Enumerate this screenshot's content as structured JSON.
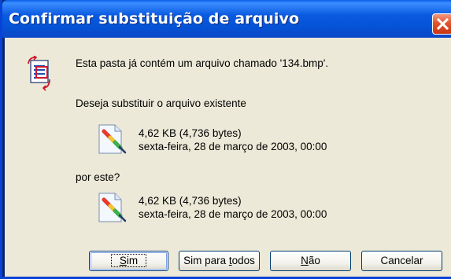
{
  "window": {
    "title": "Confirmar substituição de arquivo"
  },
  "message": {
    "intro": "Esta pasta já contém um arquivo chamado '134.bmp'.",
    "question": "Deseja substituir o arquivo existente",
    "replacement_prompt": "por este?"
  },
  "existing_file": {
    "size": "4,62 KB (4,736 bytes)",
    "date": "sexta-feira, 28 de março de 2003, 00:00",
    "icon": "bitmap-file-icon"
  },
  "new_file": {
    "size": "4,62 KB (4,736 bytes)",
    "date": "sexta-feira, 28 de março de 2003, 00:00",
    "icon": "bitmap-file-icon"
  },
  "buttons": {
    "yes": {
      "pre": "",
      "accel": "S",
      "post": "im"
    },
    "yes_all": {
      "pre": "Sim para ",
      "accel": "t",
      "post": "odos"
    },
    "no": {
      "pre": "",
      "accel": "N",
      "post": "ão"
    },
    "cancel": {
      "pre": "Cancelar",
      "accel": "",
      "post": ""
    }
  },
  "colors": {
    "titlebar": "#0553d6",
    "client_bg": "#ece9d8",
    "close_button": "#e2542c"
  }
}
